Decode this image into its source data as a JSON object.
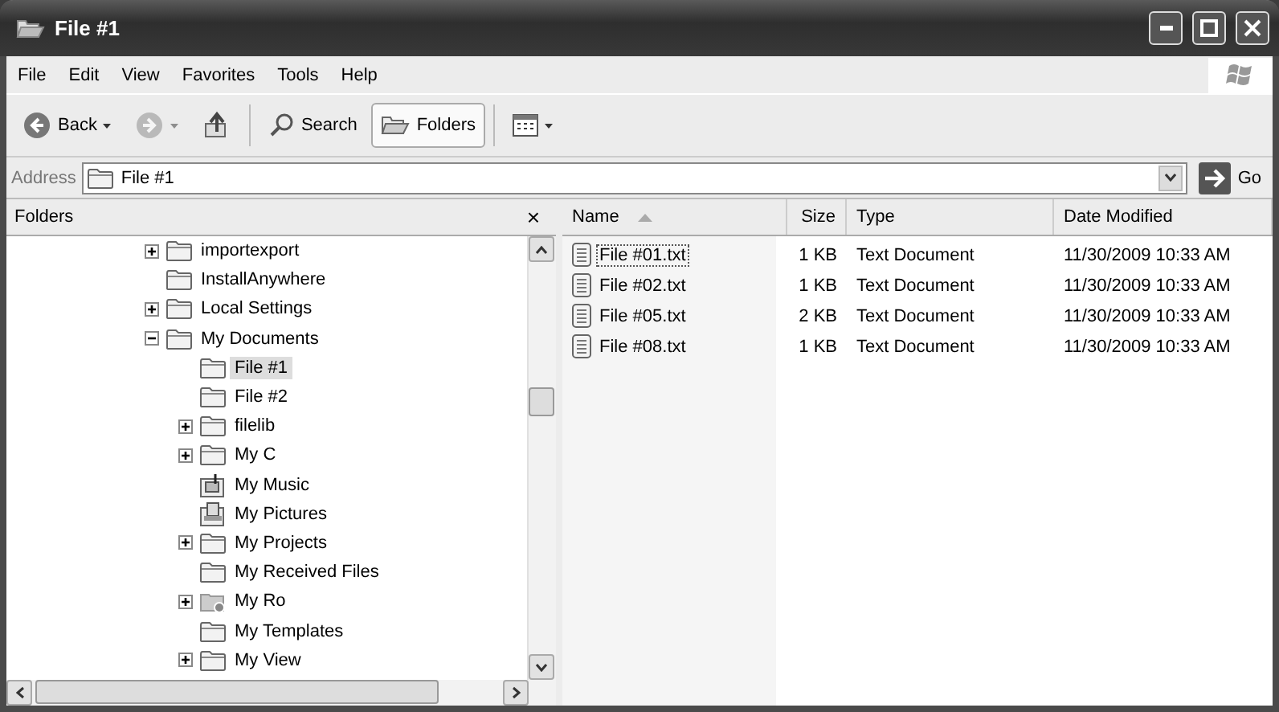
{
  "window": {
    "title": "File #1"
  },
  "menu": [
    "File",
    "Edit",
    "View",
    "Favorites",
    "Tools",
    "Help"
  ],
  "toolbar": [
    {
      "kind": "back",
      "label": "Back",
      "selected": false,
      "disabled": false
    },
    {
      "kind": "forward",
      "selected": false,
      "disabled": true
    },
    {
      "kind": "up",
      "selected": false,
      "disabled": false
    },
    {
      "kind": "search",
      "label": "Search",
      "selected": false,
      "disabled": false
    },
    {
      "kind": "folders",
      "label": "Folders",
      "selected": true,
      "disabled": false
    },
    {
      "kind": "views",
      "selected": false,
      "disabled": false
    }
  ],
  "address": {
    "label": "Address",
    "value": "File #1",
    "go": "Go"
  },
  "folders_pane": {
    "title": "Folders",
    "close": "×",
    "tree": [
      {
        "label": "importexport",
        "kind": "folder",
        "expandable": true,
        "expanded": false,
        "selected": false
      },
      {
        "label": "InstallAnywhere",
        "kind": "folder",
        "expandable": false,
        "selected": false
      },
      {
        "label": "Local Settings",
        "kind": "folder",
        "expandable": true,
        "expanded": false,
        "selected": false
      },
      {
        "label": "My Documents",
        "kind": "folder",
        "expandable": true,
        "expanded": true,
        "selected": false,
        "children": [
          {
            "label": "File #1",
            "kind": "folder",
            "expandable": false,
            "selected": true
          },
          {
            "label": "File #2",
            "kind": "folder",
            "expandable": false,
            "selected": false
          },
          {
            "label": "filelib",
            "kind": "folder",
            "expandable": true,
            "expanded": false,
            "selected": false
          },
          {
            "label": "My C",
            "kind": "folder",
            "expandable": true,
            "expanded": false,
            "selected": false
          },
          {
            "label": "My Music",
            "kind": "music",
            "expandable": false,
            "selected": false
          },
          {
            "label": "My Pictures",
            "kind": "pictures",
            "expandable": false,
            "selected": false
          },
          {
            "label": "My Projects",
            "kind": "folder",
            "expandable": true,
            "expanded": false,
            "selected": false
          },
          {
            "label": "My Received Files",
            "kind": "folder",
            "expandable": false,
            "selected": false
          },
          {
            "label": "My Ro",
            "kind": "shared",
            "expandable": true,
            "expanded": false,
            "selected": false
          },
          {
            "label": "My Templates",
            "kind": "folder",
            "expandable": false,
            "selected": false
          },
          {
            "label": "My View",
            "kind": "folder",
            "expandable": true,
            "expanded": false,
            "selected": false
          }
        ]
      }
    ]
  },
  "files": {
    "columns": [
      {
        "label": "Name",
        "sorted": true
      },
      {
        "label": "Size",
        "sorted": false
      },
      {
        "label": "Type",
        "sorted": false
      },
      {
        "label": "Date Modified",
        "sorted": false
      }
    ],
    "rows": [
      {
        "name": "File #01.txt",
        "size": "1 KB",
        "type": "Text Document",
        "date": "11/30/2009 10:33 AM",
        "selected": true
      },
      {
        "name": "File #02.txt",
        "size": "1 KB",
        "type": "Text Document",
        "date": "11/30/2009 10:33 AM",
        "selected": false
      },
      {
        "name": "File #05.txt",
        "size": "2 KB",
        "type": "Text Document",
        "date": "11/30/2009 10:33 AM",
        "selected": false
      },
      {
        "name": "File #08.txt",
        "size": "1 KB",
        "type": "Text Document",
        "date": "11/30/2009 10:33 AM",
        "selected": false
      }
    ]
  }
}
